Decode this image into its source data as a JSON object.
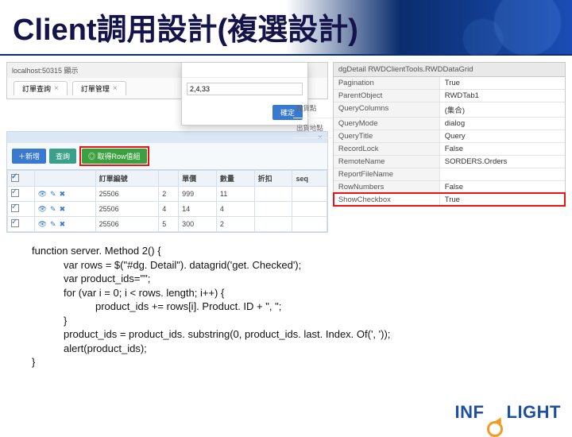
{
  "header": {
    "title": "Client調用設計(複選設計)"
  },
  "browser": {
    "url_label": "localhost:50315 顯示"
  },
  "tabs": [
    {
      "label": "訂單查詢"
    },
    {
      "label": "訂單管理"
    }
  ],
  "prompt_dialog": {
    "value": "2,4,33",
    "ok_label": "確定"
  },
  "grid_area": {
    "extra_headers": [
      "員貨點",
      "出貨地點"
    ],
    "toolbar": {
      "add_label": "＋新增",
      "query_label": "查詢",
      "method_label": "◎ 取得Row值組"
    },
    "columns": [
      "",
      "",
      "訂單編號",
      "",
      "單價",
      "數量",
      "折扣",
      "seq"
    ],
    "rows": [
      {
        "id": "25506",
        "c4": "2",
        "price": "999",
        "qty": "11",
        "disc": "",
        "seq": ""
      },
      {
        "id": "25506",
        "c4": "4",
        "price": "14",
        "qty": "4",
        "disc": "",
        "seq": ""
      },
      {
        "id": "25506",
        "c4": "5",
        "price": "300",
        "qty": "2",
        "disc": "",
        "seq": ""
      }
    ]
  },
  "property_grid": {
    "object_label": "dgDetail RWDClientTools.RWDDataGrid",
    "rows": [
      {
        "k": "Pagination",
        "v": "True"
      },
      {
        "k": "ParentObject",
        "v": "RWDTab1"
      },
      {
        "k": "QueryColumns",
        "v": "(集合)"
      },
      {
        "k": "QueryMode",
        "v": "dialog"
      },
      {
        "k": "QueryTitle",
        "v": "Query"
      },
      {
        "k": "RecordLock",
        "v": "False"
      },
      {
        "k": "RemoteName",
        "v": "SORDERS.Orders"
      },
      {
        "k": "ReportFileName",
        "v": ""
      },
      {
        "k": "RowNumbers",
        "v": "False"
      },
      {
        "k": "ShowCheckbox",
        "v": "True",
        "hl": true
      }
    ]
  },
  "code": {
    "l1": "function server. Method 2() {",
    "l2": "var rows = $(\"#dg. Detail\"). datagrid('get. Checked');",
    "l3": "var product_ids=\"\";",
    "l4": "for (var i = 0; i < rows. length; i++) {",
    "l5": "product_ids += rows[i]. Product. ID + \", \";",
    "l6": "}",
    "l7": "product_ids = product_ids. substring(0, product_ids. last. Index. Of(', '));",
    "l8": "alert(product_ids);",
    "l9": "}"
  },
  "brand": {
    "a": "INF",
    "b": "LIGHT"
  }
}
